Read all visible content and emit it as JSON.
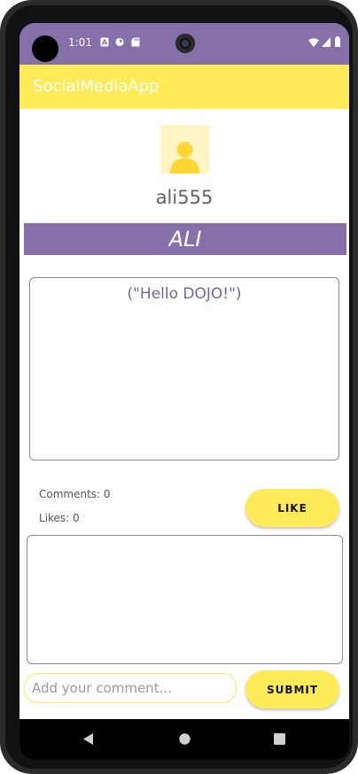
{
  "status_bar": {
    "time": "1:01",
    "left_icons": [
      "a-icon",
      "sync-icon",
      "sd-card-icon"
    ],
    "right_icons": [
      "wifi-icon",
      "signal-icon",
      "battery-icon"
    ]
  },
  "app_bar": {
    "title": "SocialMediaApp"
  },
  "profile": {
    "username": "ali555",
    "display_name": "ALI",
    "avatar_icon": "person-icon"
  },
  "post": {
    "text": "(\"Hello DOJO!\")"
  },
  "stats": {
    "comments_label": "Comments: 0",
    "likes_label": "Likes: 0"
  },
  "actions": {
    "like_label": "LIKE",
    "submit_label": "SUBMIT"
  },
  "comment_input": {
    "placeholder": "Add your comment...",
    "value": ""
  },
  "nav": {
    "buttons": [
      "back-icon",
      "home-icon",
      "recents-icon"
    ]
  },
  "colors": {
    "primary": "#8670a9",
    "accent": "#ffeb57",
    "post_text": "#7a62a3"
  }
}
